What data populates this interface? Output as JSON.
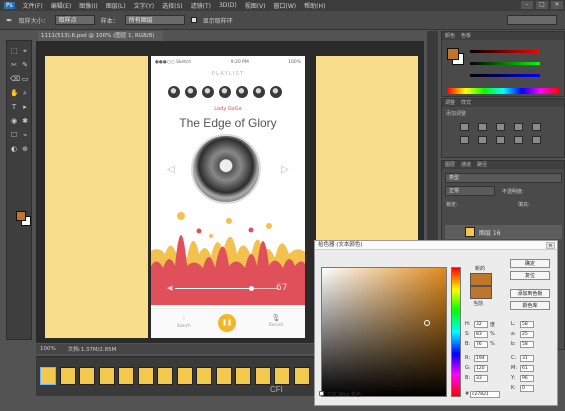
{
  "menubar": {
    "items": [
      "文件(F)",
      "编辑(E)",
      "图像(I)",
      "图层(L)",
      "文字(Y)",
      "选择(S)",
      "滤镜(T)",
      "3D(D)",
      "视图(V)",
      "窗口(W)",
      "帮助(H)"
    ]
  },
  "options": {
    "style_label": "取样大小：",
    "style_value": "取样点",
    "sample_label": "样本：",
    "sample_value": "所有图层",
    "ring_label": "显示取样环"
  },
  "document": {
    "tab_title": "1111(513).6.psd @ 100% (图层 1, RGB/8)"
  },
  "status": {
    "zoom": "100%",
    "doc_info": "文档:1.37M/2.85M"
  },
  "phone": {
    "status_time": "9:20 PM",
    "status_left": "●●●○○ Sketch",
    "status_right": "100%",
    "playlist": "PLAYLIST",
    "artist": "Lady GaGa",
    "song": "The Edge of Glory",
    "volume": "67",
    "nav_left": "Search",
    "nav_right": "Record",
    "accent": "#e0505a",
    "yellow": "#f7dd8c",
    "pause_color": "#f2b62b"
  },
  "panels": {
    "color_tabs": [
      "颜色",
      "色板"
    ],
    "adjust_tabs": [
      "调整",
      "样式"
    ],
    "adjust_add": "添加调整",
    "layers_tabs": [
      "图层",
      "通道",
      "路径"
    ],
    "layers_kind": "类型",
    "layers_mode": "正常",
    "layers_opacity": "不透明度:",
    "layers_lock": "锁定:",
    "layers_fill": "填充:",
    "layer_name": "图层 16"
  },
  "dialog": {
    "title": "拾色器 (文本颜色)",
    "close": "✕",
    "new_label": "新的",
    "current_label": "当前",
    "ok": "确定",
    "reset": "复位",
    "add_swatch": "添加到色板",
    "libraries": "颜色库",
    "web_only": "只有 Web 颜色",
    "h": "32",
    "h_unit": "度",
    "s": "83",
    "s_unit": "%",
    "b": "76",
    "b_unit": "%",
    "r": "194",
    "g": "120",
    "bl": "33",
    "L": "58",
    "a": "25",
    "b2": "58",
    "C": "31",
    "M": "61",
    "Y": "96",
    "K": "0",
    "hex": "c27821",
    "hex_label": "#",
    "current_color": "#c0762a"
  },
  "watermark": "CFI"
}
